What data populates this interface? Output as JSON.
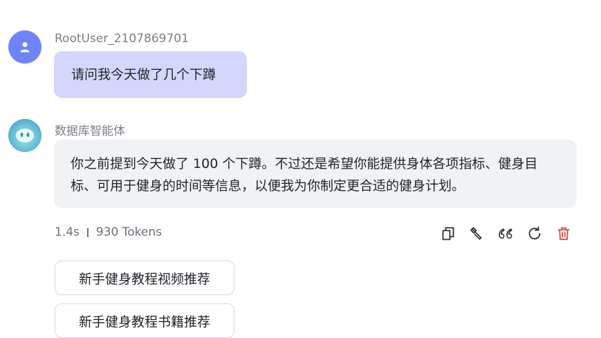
{
  "user_message": {
    "username": "RootUser_2107869701",
    "text": "请问我今天做了几个下蹲",
    "avatar_color": "#6f85f7"
  },
  "bot_message": {
    "name": "数据库智能体",
    "text": "你之前提到今天做了 100 个下蹲。不过还是希望你能提供身体各项指标、健身目标、可用于健身的时间等信息，以便我为你制定更合适的健身计划。"
  },
  "meta": {
    "duration": "1.4s",
    "tokens": "930 Tokens"
  },
  "actions": [
    {
      "icon": "copy-icon"
    },
    {
      "icon": "wrench-icon"
    },
    {
      "icon": "quote-icon",
      "glyph": "66"
    },
    {
      "icon": "refresh-icon"
    },
    {
      "icon": "trash-icon",
      "color": "#e0423a"
    }
  ],
  "suggestions": [
    {
      "label": "新手健身教程视频推荐"
    },
    {
      "label": "新手健身教程书籍推荐"
    }
  ],
  "colors": {
    "user_bubble": "#d4d7fb",
    "bot_bubble": "#f1f2f4",
    "danger": "#e0423a"
  }
}
